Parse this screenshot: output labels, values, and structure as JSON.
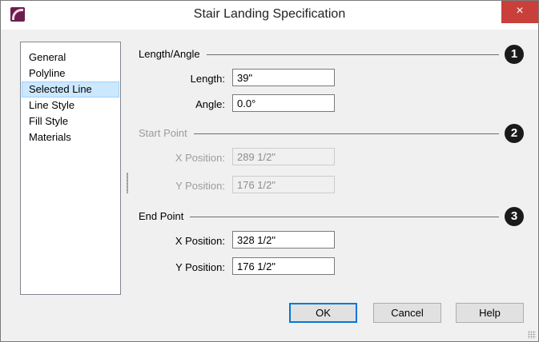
{
  "window": {
    "title": "Stair Landing Specification",
    "close_symbol": "×"
  },
  "nav": {
    "items": [
      {
        "label": "General"
      },
      {
        "label": "Polyline"
      },
      {
        "label": "Selected Line"
      },
      {
        "label": "Line Style"
      },
      {
        "label": "Fill Style"
      },
      {
        "label": "Materials"
      }
    ],
    "selected": "Selected Line"
  },
  "length_angle": {
    "title": "Length/Angle",
    "badge": "1",
    "length_label": "Length:",
    "length_value": "39\"",
    "angle_label": "Angle:",
    "angle_value": "0.0°"
  },
  "start_point": {
    "title": "Start Point",
    "badge": "2",
    "x_label": "X Position:",
    "x_value": "289 1/2\"",
    "y_label": "Y Position:",
    "y_value": "176 1/2\"",
    "enabled": false
  },
  "end_point": {
    "title": "End Point",
    "badge": "3",
    "x_label": "X Position:",
    "x_value": "328 1/2\"",
    "y_label": "Y Position:",
    "y_value": "176 1/2\""
  },
  "buttons": {
    "ok": "OK",
    "cancel": "Cancel",
    "help": "Help"
  },
  "colors": {
    "close_button": "#c9403b",
    "selection": "#cce8ff",
    "default_button_border": "#0078d7"
  }
}
